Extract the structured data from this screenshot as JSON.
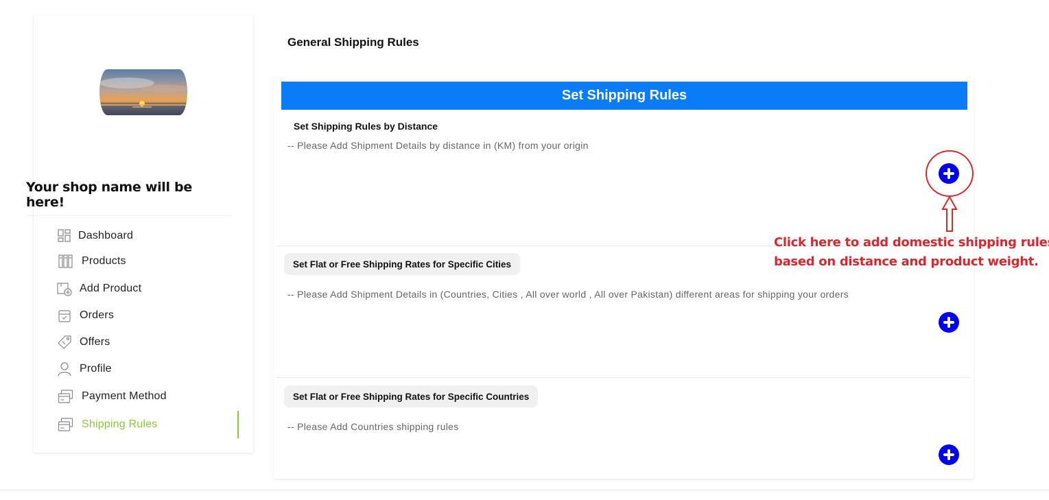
{
  "page_title": "General Shipping Rules",
  "sidebar": {
    "shop_name": "Your shop name will be here!",
    "items": [
      {
        "label": "Dashboard",
        "icon": "dashboard-icon"
      },
      {
        "label": "Products",
        "icon": "products-icon"
      },
      {
        "label": "Add Product",
        "icon": "add-product-icon"
      },
      {
        "label": "Orders",
        "icon": "orders-icon"
      },
      {
        "label": "Offers",
        "icon": "offers-tag-icon"
      },
      {
        "label": "Profile",
        "icon": "profile-icon"
      },
      {
        "label": "Payment Method",
        "icon": "payment-card-icon"
      },
      {
        "label": "Shipping Rules",
        "icon": "shipping-card-icon",
        "active": true
      }
    ]
  },
  "main": {
    "banner": "Set Shipping Rules",
    "sections": [
      {
        "title": "Set Shipping Rules by Distance",
        "description": "-- Please Add Shipment Details by distance in (KM) from your origin"
      },
      {
        "title": "Set Flat or Free Shipping Rates for Specific Cities",
        "description": "-- Please Add Shipment Details in (Countries, Cities , All over world , All over Pakistan) different areas for shipping your orders"
      },
      {
        "title": "Set Flat or Free Shipping Rates for Specific Countries",
        "description": "-- Please Add Countries shipping rules"
      }
    ]
  },
  "annotation": {
    "line1": "Click here to add domestic shipping rules",
    "line2": "based on distance and product weight."
  },
  "colors": {
    "banner": "#0a7cf8",
    "add_button": "#0000ee",
    "active_nav": "#8cc63f",
    "annotation": "#d6282f"
  }
}
